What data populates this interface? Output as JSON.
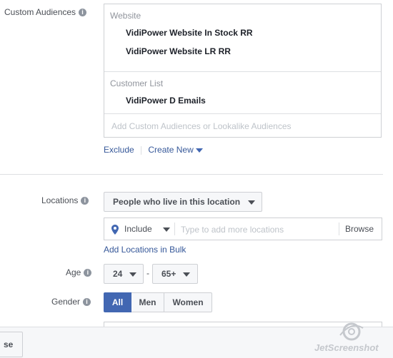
{
  "custom_audiences": {
    "label": "Custom Audiences",
    "groups": [
      {
        "heading": "Website",
        "items": [
          "VidiPower Website In Stock RR",
          "VidiPower Website LR RR"
        ]
      },
      {
        "heading": "Customer List",
        "items": [
          "VidiPower D Emails"
        ]
      }
    ],
    "placeholder": "Add Custom Audiences or Lookalike Audiences",
    "exclude_label": "Exclude",
    "create_new_label": "Create New"
  },
  "locations": {
    "label": "Locations",
    "type_dropdown": "People who live in this location",
    "include_label": "Include",
    "input_placeholder": "Type to add more locations",
    "browse_label": "Browse",
    "bulk_link": "Add Locations in Bulk"
  },
  "age": {
    "label": "Age",
    "min": "24",
    "separator": "-",
    "max": "65+"
  },
  "gender": {
    "label": "Gender",
    "options": [
      "All",
      "Men",
      "Women"
    ],
    "selected": "All"
  },
  "footer": {
    "button_label": "se"
  },
  "watermark": "JetScreenshot",
  "colors": {
    "accent": "#4267b2",
    "link": "#365899",
    "border": "#ced0d4"
  }
}
